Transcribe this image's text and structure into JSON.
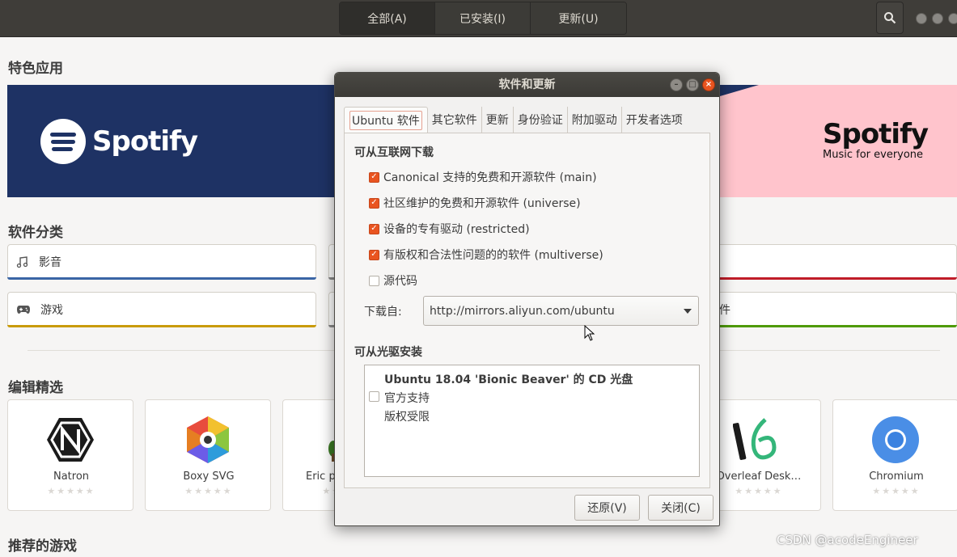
{
  "header": {
    "tabs": [
      {
        "label": "全部(A)"
      },
      {
        "label": "已安装(I)"
      },
      {
        "label": "更新(U)"
      }
    ]
  },
  "main": {
    "featured_title": "特色应用",
    "banner": {
      "left_brand": "Spotify",
      "right_brand": "Spotify",
      "right_tagline": "Music for everyone"
    },
    "categories_title": "软件分类",
    "categories": [
      {
        "label": "影音",
        "icon": "music-note-icon",
        "color": "#3a65a5"
      },
      {
        "label": "游戏",
        "icon": "gamepad-icon",
        "color": "#c99b0a"
      }
    ],
    "right_category_partial": "件",
    "right_category_colors": [
      "#c01c28",
      "#4e9a06"
    ],
    "editors_title": "编辑精选",
    "apps": [
      {
        "name": "Natron",
        "stars": "★★★★★"
      },
      {
        "name": "Boxy SVG",
        "stars": "★★★★★"
      },
      {
        "name": "Eric p",
        "stars": "★★★★★"
      },
      {
        "name": "Overleaf Desk…",
        "stars": "★★★★★"
      },
      {
        "name": "Chromium",
        "stars": "★★★★★"
      }
    ],
    "recommended_games_title": "推荐的游戏"
  },
  "dialog": {
    "title": "软件和更新",
    "tabs": [
      {
        "label": "Ubuntu 软件"
      },
      {
        "label": "其它软件"
      },
      {
        "label": "更新"
      },
      {
        "label": "身份验证"
      },
      {
        "label": "附加驱动"
      },
      {
        "label": "开发者选项"
      }
    ],
    "internet_group": "可从互联网下载",
    "sources": [
      {
        "label": "Canonical 支持的免费和开源软件 (main)",
        "checked": true
      },
      {
        "label": "社区维护的免费和开源软件 (universe)",
        "checked": true
      },
      {
        "label": "设备的专有驱动 (restricted)",
        "checked": true
      },
      {
        "label": "有版权和合法性问题的的软件 (multiverse)",
        "checked": true
      },
      {
        "label": "源代码",
        "checked": false
      }
    ],
    "download_from_label": "下载自:",
    "download_from_value": "http://mirrors.aliyun.com/ubuntu",
    "cdrom_group": "可从光驱安装",
    "cdrom": {
      "title": "Ubuntu 18.04 'Bionic Beaver' 的 CD 光盘",
      "line1": "官方支持",
      "line2": "版权受限",
      "checked": false
    },
    "revert_button": "还原(V)",
    "close_button": "关闭(C)"
  },
  "watermark": "CSDN @acodeEngineer"
}
